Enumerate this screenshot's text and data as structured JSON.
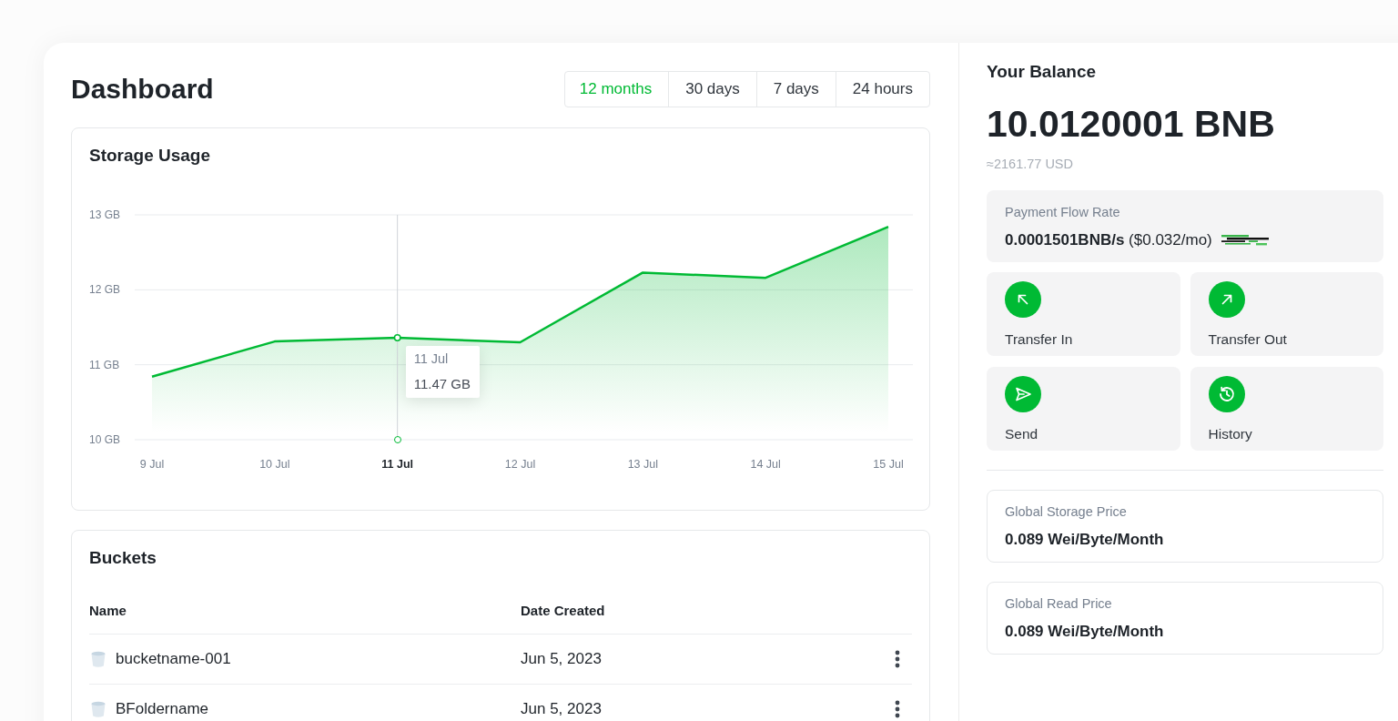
{
  "main": {
    "title": "Dashboard",
    "ranges": [
      {
        "label": "12 months",
        "selected": true
      },
      {
        "label": "30 days",
        "selected": false
      },
      {
        "label": "7 days",
        "selected": false
      },
      {
        "label": "24 hours",
        "selected": false
      }
    ]
  },
  "storage_usage": {
    "title": "Storage Usage",
    "chart_data": {
      "type": "area",
      "categories": [
        "9 Jul",
        "10 Jul",
        "11 Jul",
        "12 Jul",
        "13 Jul",
        "14 Jul",
        "15 Jul"
      ],
      "series": [
        {
          "color": "#00ba34",
          "values": [
            10.84,
            11.31,
            11.36,
            11.3,
            12.23,
            12.16,
            12.84
          ]
        }
      ],
      "ylim": [
        10,
        13
      ],
      "yticks": [
        {
          "value": 10,
          "label": "10 GB"
        },
        {
          "value": 11,
          "label": "11 GB"
        },
        {
          "value": 12,
          "label": "12 GB"
        },
        {
          "value": 13,
          "label": "13 GB"
        }
      ],
      "ref_lines": [
        {
          "axis": "x",
          "value": "11 Jul"
        }
      ]
    },
    "tooltip": {
      "date": "11 Jul",
      "value": "11.47 GB"
    }
  },
  "buckets": {
    "title": "Buckets",
    "columns": [
      "Name",
      "Date Created"
    ],
    "rows": [
      {
        "name": "bucketname-001",
        "date_created": "Jun 5, 2023"
      },
      {
        "name": "BFoldername",
        "date_created": "Jun 5, 2023"
      }
    ]
  },
  "balance": {
    "title": "Your Balance",
    "amount": "10.0120001 BNB",
    "fiat_value": "≈2161.77 USD"
  },
  "payment_flow_rate": {
    "label": "Payment Flow Rate",
    "value": "**0.0001501BNB/s** ($0.032/mo)"
  },
  "actions": [
    {
      "kind": "transfer_in",
      "label": "Transfer In"
    },
    {
      "kind": "transfer_out",
      "label": "Transfer Out"
    },
    {
      "kind": "send",
      "label": "Send"
    },
    {
      "kind": "history",
      "label": "History"
    }
  ],
  "prices": [
    {
      "label": "Global Storage Price",
      "value": "0.089 Wei/Byte/Month"
    },
    {
      "label": "Global Read Price",
      "value": "0.089 Wei/Byte/Month"
    }
  ]
}
